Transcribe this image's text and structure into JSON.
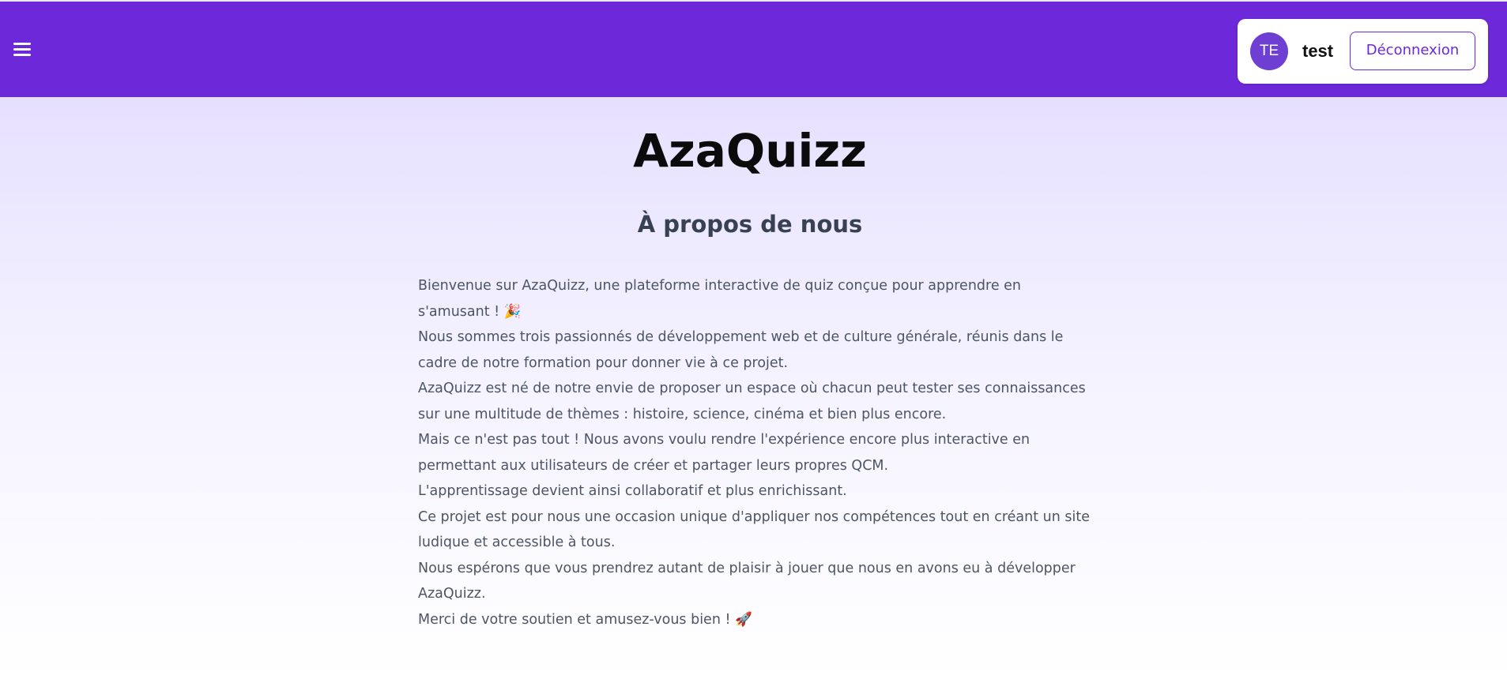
{
  "navbar": {
    "menu_icon": "hamburger-menu-icon",
    "background": "#6d28d9",
    "user": {
      "initials": "TE",
      "name": "test",
      "logout_label": "Déconnexion"
    }
  },
  "main": {
    "title": "AzaQuizz",
    "subtitle": "À propos de nous",
    "paragraphs": [
      "Bienvenue sur AzaQuizz, une plateforme interactive de quiz conçue pour apprendre en s'amusant ! 🎉",
      "Nous sommes trois passionnés de développement web et de culture générale, réunis dans le cadre de notre formation pour donner vie à ce projet.",
      "AzaQuizz est né de notre envie de proposer un espace où chacun peut tester ses connaissances sur une multitude de thèmes : histoire, science, cinéma et bien plus encore.",
      "Mais ce n'est pas tout ! Nous avons voulu rendre l'expérience encore plus interactive en permettant aux utilisateurs de créer et partager leurs propres QCM.",
      "L'apprentissage devient ainsi collaboratif et plus enrichissant.",
      "Ce projet est pour nous une occasion unique d'appliquer nos compétences tout en créant un site ludique et accessible à tous.",
      "Nous espérons que vous prendrez autant de plaisir à jouer que nous en avons eu à développer AzaQuizz.",
      "Merci de votre soutien et amusez-vous bien ! 🚀"
    ]
  }
}
